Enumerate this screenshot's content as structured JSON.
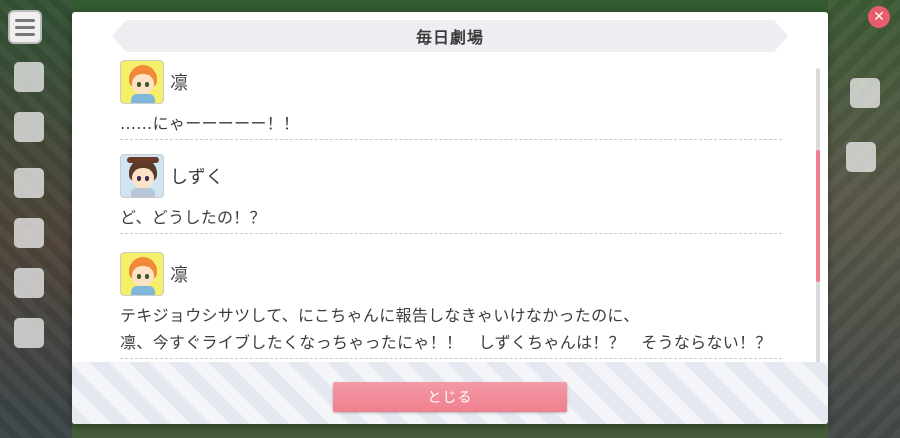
{
  "dialog": {
    "title": "毎日劇場",
    "close_label": "とじる"
  },
  "entries": [
    {
      "speaker": "凛",
      "avatar_icon": "rin-avatar-icon",
      "lines": [
        "……にゃーーーーー！！"
      ]
    },
    {
      "speaker": "しずく",
      "avatar_icon": "shizuku-avatar-icon",
      "lines": [
        "ど、どうしたの！？"
      ]
    },
    {
      "speaker": "凛",
      "avatar_icon": "rin-avatar-icon",
      "lines": [
        "テキジョウシサツして、にこちゃんに報告しなきゃいけなかったのに、",
        "凛、今すぐライブしたくなっちゃったにゃ！！　しずくちゃんは！？　そうならない！？"
      ]
    }
  ],
  "colors": {
    "accent": "#ef7f8e",
    "text": "#3c3c3c",
    "header_bg": "#eceef2"
  }
}
